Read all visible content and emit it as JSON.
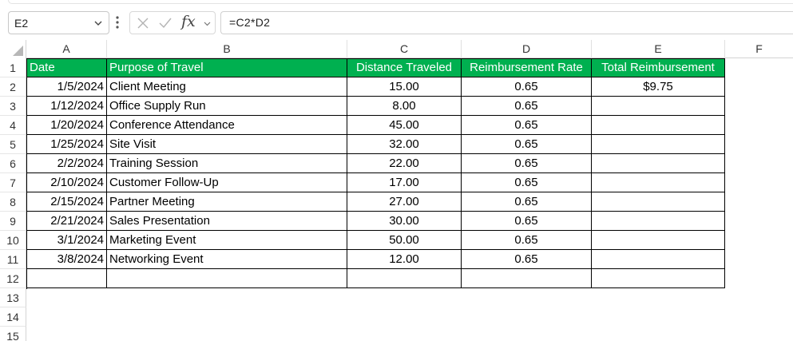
{
  "name_box": {
    "value": "E2"
  },
  "formula_bar": {
    "formula": "=C2*D2",
    "fx_label": "fx"
  },
  "columns": [
    "A",
    "B",
    "C",
    "D",
    "E",
    "F"
  ],
  "row_numbers": [
    "1",
    "2",
    "3",
    "4",
    "5",
    "6",
    "7",
    "8",
    "9",
    "10",
    "11",
    "12",
    "13",
    "14",
    "15"
  ],
  "table": {
    "headers": [
      "Date",
      "Purpose of Travel",
      "Distance Traveled",
      "Reimbursement Rate",
      "Total Reimbursement"
    ],
    "rows": [
      [
        "1/5/2024",
        "Client Meeting",
        "15.00",
        "0.65",
        "$9.75"
      ],
      [
        "1/12/2024",
        "Office Supply Run",
        "8.00",
        "0.65",
        ""
      ],
      [
        "1/20/2024",
        "Conference Attendance",
        "45.00",
        "0.65",
        ""
      ],
      [
        "1/25/2024",
        "Site Visit",
        "32.00",
        "0.65",
        ""
      ],
      [
        "2/2/2024",
        "Training Session",
        "22.00",
        "0.65",
        ""
      ],
      [
        "2/10/2024",
        "Customer Follow-Up",
        "17.00",
        "0.65",
        ""
      ],
      [
        "2/15/2024",
        "Partner Meeting",
        "27.00",
        "0.65",
        ""
      ],
      [
        "2/21/2024",
        "Sales Presentation",
        "30.00",
        "0.65",
        ""
      ],
      [
        "3/1/2024",
        "Marketing Event",
        "50.00",
        "0.65",
        ""
      ],
      [
        "3/8/2024",
        "Networking Event",
        "12.00",
        "0.65",
        ""
      ],
      [
        "",
        "",
        "",
        "",
        ""
      ]
    ]
  },
  "colors": {
    "header_fill": "#00b050",
    "header_text": "#ffffff"
  },
  "icons": {
    "name_box": "chevron-down-icon",
    "cancel": "close-icon",
    "enter": "checkmark-icon",
    "more": "vertical-dots-icon"
  }
}
